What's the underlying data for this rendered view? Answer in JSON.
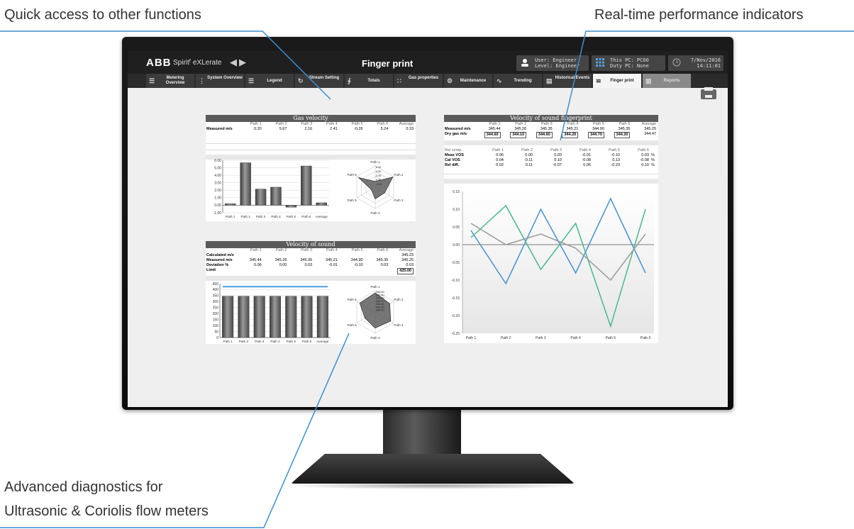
{
  "callouts": {
    "top_left": "Quick access to other functions",
    "top_right": "Real-time performance indicators",
    "bottom_left_line1": "Advanced diagnostics for",
    "bottom_left_line2": "Ultrasonic & Coriolis flow meters"
  },
  "app": {
    "logo": "ABB",
    "product": "Spiritᶠ eXLerate",
    "title": "Finger print",
    "user_line1": "User: Engineer",
    "user_line2": "Level: Engineer",
    "pc_line1": "This PC: PC60",
    "pc_line2": "Duty PC: None",
    "date": "7/Nov/2016",
    "time": "14:11:01"
  },
  "tabs": [
    {
      "label": "Metering Overview",
      "icon": "menu-icon"
    },
    {
      "label": "System Overview",
      "icon": "system-icon"
    },
    {
      "label": "Legend",
      "icon": "legend-icon"
    },
    {
      "label": "Stream Setting",
      "icon": "stream-icon"
    },
    {
      "label": "Totals",
      "icon": "totals-icon"
    },
    {
      "label": "Gas properties",
      "icon": "molecule-icon"
    },
    {
      "label": "Maintenance",
      "icon": "wrench-icon"
    },
    {
      "label": "Trending",
      "icon": "trend-icon"
    },
    {
      "label": "Historical Events",
      "icon": "events-icon"
    },
    {
      "label": "Finger print",
      "icon": "fingerprint-icon"
    },
    {
      "label": "Reports",
      "icon": "reports-icon"
    }
  ],
  "colors": {
    "accent_blue": "#4a90d0",
    "accent_green": "#4bb88a",
    "grey_line": "#9a9a9a"
  },
  "gas_velocity": {
    "title": "Gas velocity",
    "headers": [
      "Path 1",
      "Path 2",
      "Path 3",
      "Path 4",
      "Path 5",
      "Path 6",
      "Average"
    ],
    "row_label": "Measured m/s",
    "values": [
      "0.20",
      "5.67",
      "2.16",
      "2.41",
      "-0.26",
      "5.24",
      "0.33"
    ]
  },
  "velocity_of_sound": {
    "title": "Velocity of sound",
    "headers": [
      "Path 1",
      "Path 2",
      "Path 3",
      "Path 4",
      "Path 5",
      "Path 6",
      "Average"
    ],
    "calc_label": "Calculated m/s",
    "calc_value": "345.23",
    "meas_label": "Measured m/s",
    "meas_values": [
      "345.44",
      "345.26",
      "345.35",
      "345.21",
      "344.90",
      "345.35",
      "345.25"
    ],
    "dev_label": "Deviation %",
    "dev_values": [
      "0.06",
      "0.00",
      "0.03",
      "-0.01",
      "-0.10",
      "0.03",
      "0.03"
    ],
    "limit_label": "Limit",
    "limit_value": "425.00"
  },
  "vos_fingerprint": {
    "title": "Velocity of sound fingerprint",
    "headers": [
      "Path 1",
      "Path 2",
      "Path 3",
      "Path 4",
      "Path 5",
      "Path 6",
      "Average"
    ],
    "meas_label": "Measured m/s",
    "meas_values": [
      "345.44",
      "345.26",
      "345.35",
      "345.21",
      "344.90",
      "345.35",
      "345.25"
    ],
    "dry_label": "Dry gas m/s",
    "dry_values": [
      "344.60",
      "344.10",
      "344.60",
      "344.20",
      "344.70",
      "344.20",
      "344.47"
    ],
    "rel_headers": [
      "Rel comp.",
      "Path 1",
      "Path 2",
      "Path 3",
      "Path 4",
      "Path 5",
      "Path 6"
    ],
    "rel_rows": [
      {
        "label": "Meas VOS",
        "values": [
          "0.06",
          "0.00",
          "0.03",
          "-0.01",
          "-0.10",
          "0.03"
        ],
        "unit": "%"
      },
      {
        "label": "Cal VOS",
        "values": [
          "0.04",
          "-0.11",
          "0.10",
          "-0.08",
          "0.13",
          "-0.08"
        ],
        "unit": "%"
      },
      {
        "label": "Rel diff.",
        "values": [
          "0.02",
          "0.11",
          "-0.07",
          "0.06",
          "-0.23",
          "0.10"
        ],
        "unit": "%"
      }
    ]
  },
  "chart_data": [
    {
      "type": "bar",
      "categories": [
        "Path 1",
        "Path 2",
        "Path 3",
        "Path 4",
        "Path 5",
        "Path 6",
        "Average"
      ],
      "values": [
        0.2,
        5.67,
        2.16,
        2.41,
        -0.26,
        5.24,
        0.33
      ],
      "ylim": [
        -1,
        6
      ],
      "yticks": [
        "6.00",
        "5.00",
        "4.00",
        "3.00",
        "2.00",
        "1.00",
        "0.00",
        "-1.00"
      ],
      "grid": true
    },
    {
      "type": "radar",
      "axes": [
        "Path 1",
        "Path 2",
        "Path 3",
        "Path 4",
        "Path 5",
        "Path 6"
      ],
      "values": [
        0.2,
        5.67,
        2.16,
        2.41,
        -0.26,
        5.24
      ],
      "rlim": [
        -2,
        6
      ],
      "rticks": [
        "6.00",
        "4.00",
        "2.00",
        "0.00",
        "-2.00"
      ]
    },
    {
      "type": "bar",
      "categories": [
        "Path 1",
        "Path 2",
        "Path 3",
        "Path 4",
        "Path 5",
        "Path 6",
        "Average"
      ],
      "values": [
        345.44,
        345.26,
        345.35,
        345.21,
        344.9,
        345.35,
        345.25
      ],
      "limit": 425,
      "ylim": [
        0,
        450
      ],
      "yticks": [
        "450",
        "400",
        "350",
        "300",
        "250",
        "200",
        "150",
        "100",
        "50",
        "0"
      ],
      "grid": true
    },
    {
      "type": "radar",
      "axes": [
        "Path 1",
        "Path 2",
        "Path 3",
        "Path 4",
        "Path 5",
        "Path 6"
      ],
      "values": [
        345.44,
        345.26,
        345.35,
        345.21,
        344.9,
        345.35
      ],
      "rlim": [
        344,
        345.6
      ],
      "rticks": [
        "345.60",
        "345.40",
        "345.20",
        "345.00",
        "344.80",
        "344.60",
        "344.40"
      ]
    },
    {
      "type": "line",
      "categories": [
        "Path 1",
        "Path 2",
        "Path 3",
        "Path 4",
        "Path 5",
        "Path 6"
      ],
      "series": [
        {
          "color": "#4a90d0",
          "values": [
            0.04,
            -0.11,
            0.1,
            -0.08,
            0.13,
            -0.08
          ]
        },
        {
          "color": "#4bb88a",
          "values": [
            0.02,
            0.11,
            -0.07,
            0.06,
            -0.23,
            0.1
          ]
        },
        {
          "color": "#9a9a9a",
          "values": [
            0.06,
            0.0,
            0.03,
            -0.01,
            -0.1,
            0.03
          ]
        }
      ],
      "ylim": [
        -0.25,
        0.15
      ],
      "yticks": [
        "0.15",
        "0.10",
        "0.05",
        "0.00",
        "-0.05",
        "-0.10",
        "-0.15",
        "-0.20",
        "-0.25"
      ],
      "grid": false
    }
  ]
}
